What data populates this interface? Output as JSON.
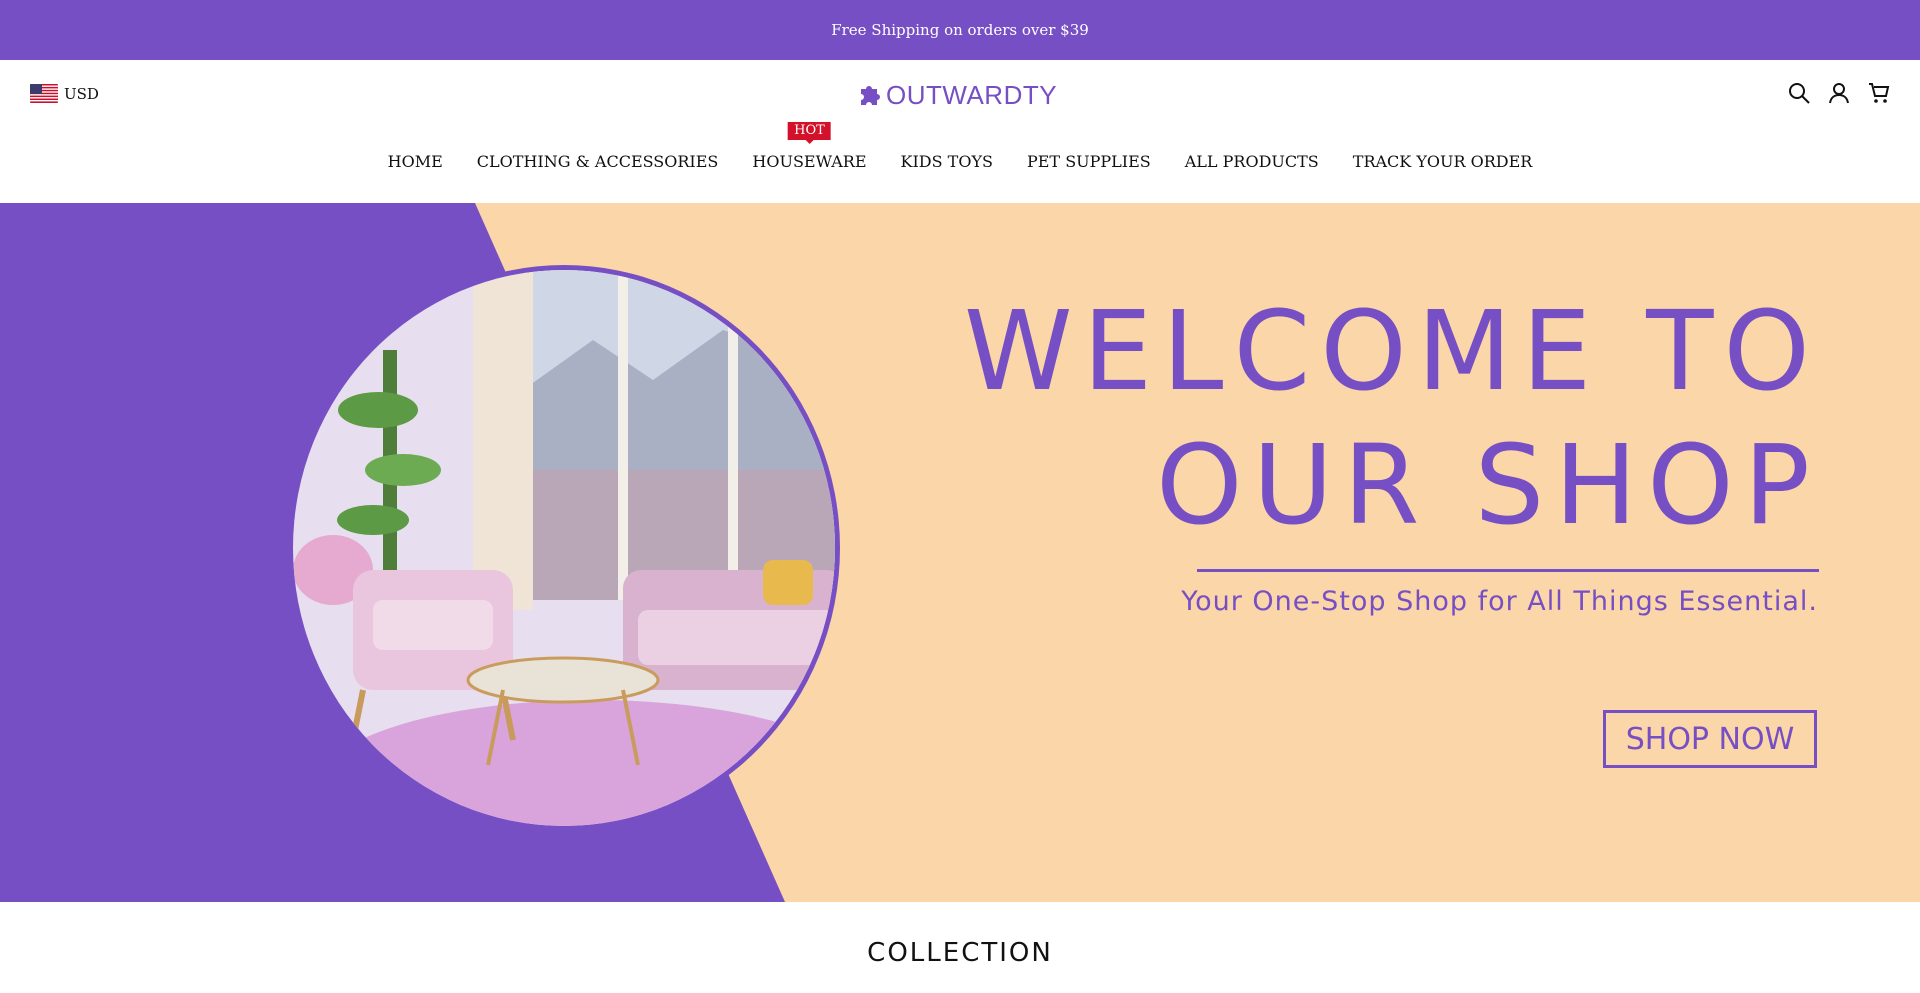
{
  "announcement": {
    "text": "Free Shipping on orders over $39"
  },
  "header": {
    "currency": {
      "flag": "us-flag-icon",
      "code": "USD"
    },
    "logo": {
      "text": "OUTWARDTY"
    },
    "icons": [
      "search-icon",
      "account-icon",
      "cart-icon"
    ]
  },
  "nav": {
    "items": [
      {
        "label": "HOME"
      },
      {
        "label": "CLOTHING & ACCESSORIES"
      },
      {
        "label": "HOUSEWARE",
        "badge": "HOT"
      },
      {
        "label": "KIDS TOYS"
      },
      {
        "label": "PET SUPPLIES"
      },
      {
        "label": "ALL PRODUCTS"
      },
      {
        "label": "TRACK YOUR ORDER"
      }
    ]
  },
  "hero": {
    "headline_line1": "WELCOME TO",
    "headline_line2": "OUR SHOP",
    "tagline": "Your One-Stop Shop for All Things Essential.",
    "cta": "SHOP NOW"
  },
  "section": {
    "title": "COLLECTION"
  },
  "colors": {
    "brand": "#774fc4",
    "peach": "#fad6a8",
    "hot": "#d4112b"
  }
}
